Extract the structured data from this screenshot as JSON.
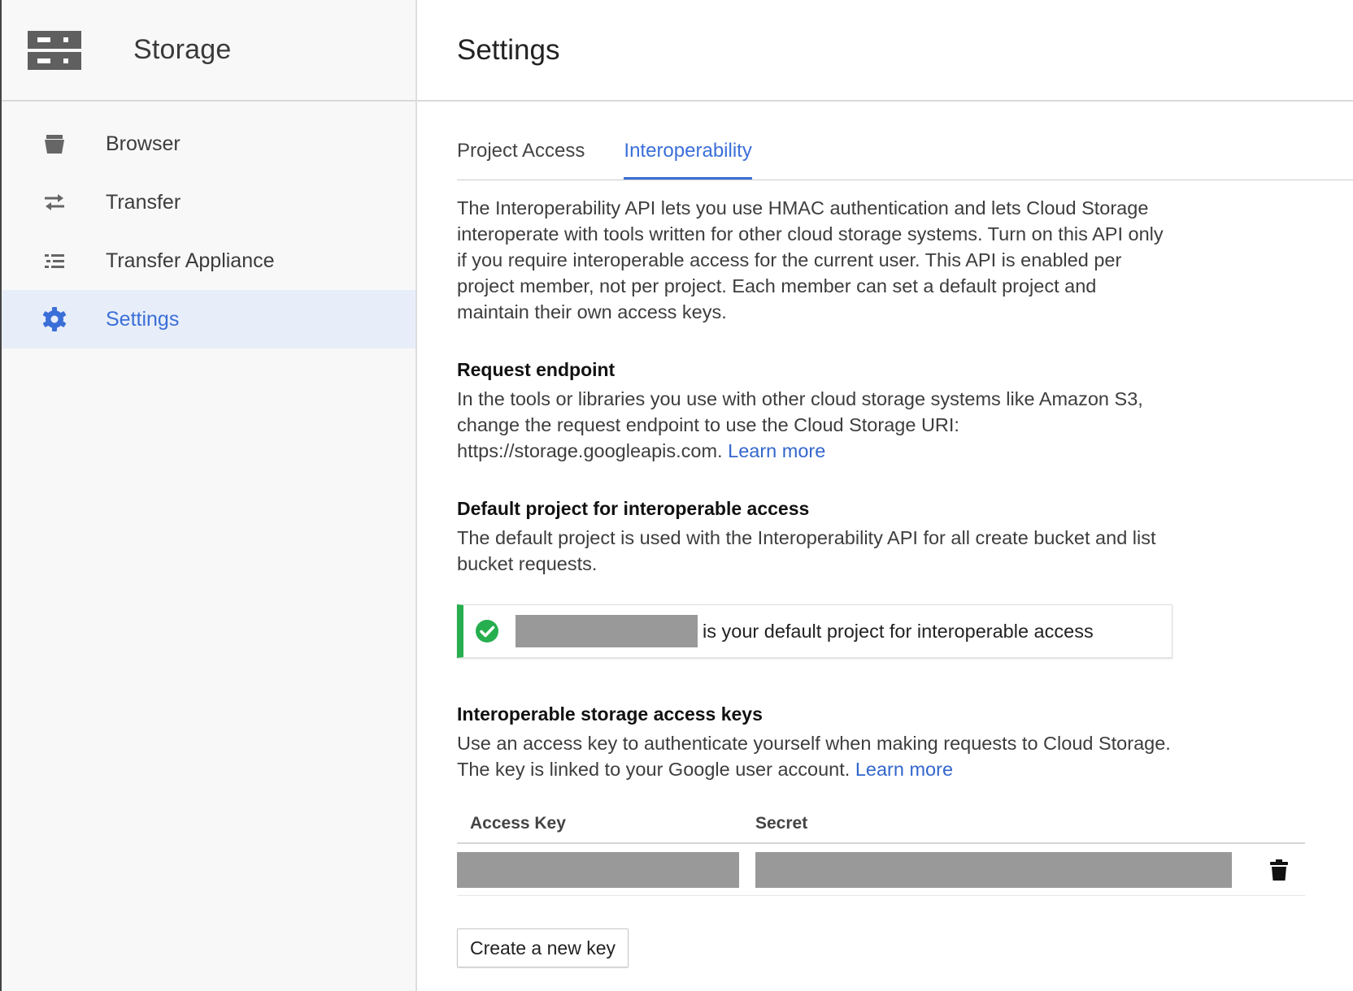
{
  "sidebar": {
    "product_title": "Storage",
    "items": [
      {
        "label": "Browser",
        "icon": "bucket-icon",
        "active": false
      },
      {
        "label": "Transfer",
        "icon": "transfer-arrows-icon",
        "active": false
      },
      {
        "label": "Transfer Appliance",
        "icon": "list-icon",
        "active": false
      },
      {
        "label": "Settings",
        "icon": "gear-icon",
        "active": true
      }
    ]
  },
  "header": {
    "title": "Settings"
  },
  "tabs": [
    {
      "label": "Project Access",
      "active": false
    },
    {
      "label": "Interoperability",
      "active": true
    }
  ],
  "intro": "The Interoperability API lets you use HMAC authentication and lets Cloud Storage interoperate with tools written for other cloud storage systems. Turn on this API only if you require interoperable access for the current user. This API is enabled per project member, not per project. Each member can set a default project and maintain their own access keys.",
  "request_endpoint": {
    "title": "Request endpoint",
    "text": "In the tools or libraries you use with other cloud storage systems like Amazon S3, change the request endpoint to use the Cloud Storage URI: https://storage.googleapis.com.",
    "link": "Learn more"
  },
  "default_project": {
    "title": "Default project for interoperable access",
    "text": "The default project is used with the Interoperability API for all create bucket and list bucket requests.",
    "notice": "is your default project for interoperable access"
  },
  "access_keys": {
    "title": "Interoperable storage access keys",
    "text": "Use an access key to authenticate yourself when making requests to Cloud Storage. The key is linked to your Google user account.",
    "link": "Learn more",
    "columns": {
      "access_key": "Access Key",
      "secret": "Secret"
    },
    "create_button": "Create a new key"
  },
  "colors": {
    "accent": "#3b6fd8",
    "success": "#27ae4f",
    "redaction": "#999999"
  }
}
